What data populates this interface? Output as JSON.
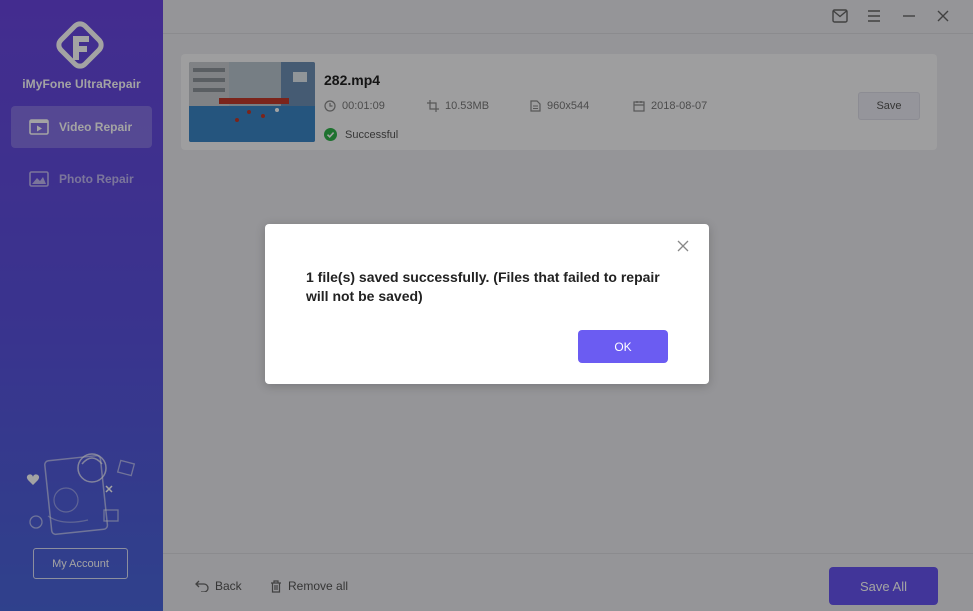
{
  "app": {
    "name": "iMyFone UltraRepair"
  },
  "sidebar": {
    "items": [
      {
        "label": "Video Repair",
        "icon": "video-icon",
        "active": true
      },
      {
        "label": "Photo Repair",
        "icon": "photo-icon",
        "active": false
      }
    ],
    "account_label": "My Account"
  },
  "file": {
    "name": "282.mp4",
    "duration": "00:01:09",
    "size": "10.53MB",
    "resolution": "960x544",
    "date": "2018-08-07",
    "status": "Successful",
    "save_label": "Save"
  },
  "bottom": {
    "back_label": "Back",
    "remove_all_label": "Remove all",
    "save_all_label": "Save All"
  },
  "dialog": {
    "message": "1 file(s) saved successfully. (Files that failed to repair will not be saved)",
    "ok_label": "OK"
  },
  "colors": {
    "accent": "#6b5cf2",
    "sidebar_top": "#6a46e0",
    "sidebar_bottom": "#4a66db",
    "success": "#2fb24a"
  }
}
